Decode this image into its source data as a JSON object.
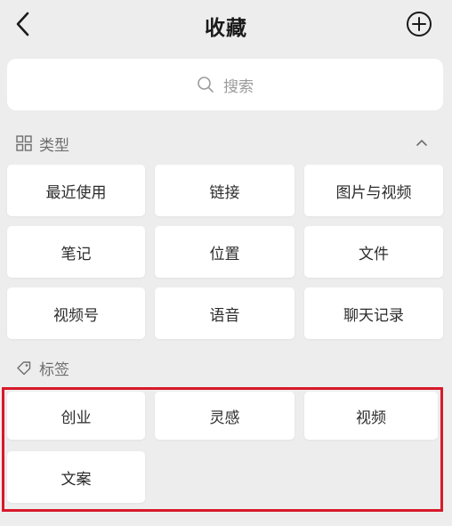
{
  "header": {
    "title": "收藏",
    "back_icon": "back-chevron-icon",
    "add_icon": "add-circle-icon"
  },
  "search": {
    "placeholder": "搜索",
    "icon": "search-icon"
  },
  "types_section": {
    "label": "类型",
    "icon": "grid-icon",
    "collapse_icon": "chevron-up-icon",
    "items": [
      "最近使用",
      "链接",
      "图片与视频",
      "笔记",
      "位置",
      "文件",
      "视频号",
      "语音",
      "聊天记录"
    ]
  },
  "tags_section": {
    "label": "标签",
    "icon": "tag-icon",
    "items": [
      "创业",
      "灵感",
      "视频",
      "文案"
    ]
  },
  "colors": {
    "background": "#ededed",
    "tile": "#ffffff",
    "highlight_border": "#d7192a",
    "muted_text": "#6e6e6e"
  }
}
